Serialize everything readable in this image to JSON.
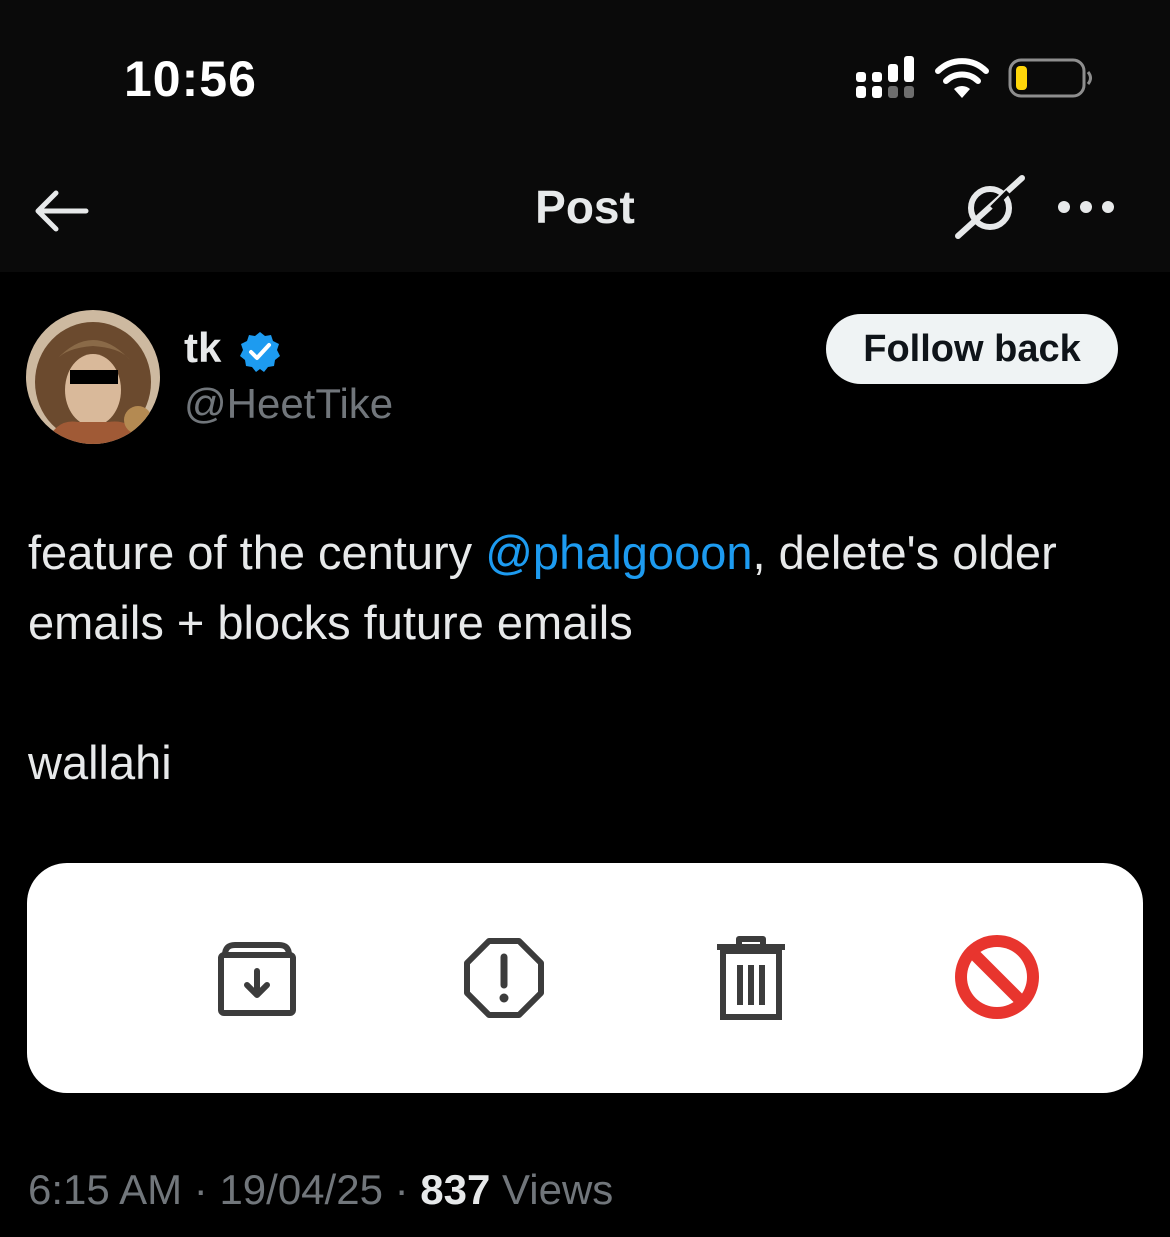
{
  "status_bar": {
    "time": "10:56",
    "icons": [
      "signal-icon",
      "wifi-icon",
      "battery-icon"
    ],
    "battery_color": "#ffd60a"
  },
  "nav": {
    "title": "Post",
    "icons": [
      "back-arrow-icon",
      "grok-icon",
      "more-options-icon"
    ]
  },
  "author": {
    "display_name": "tk",
    "handle": "@HeetTike",
    "verified": true,
    "follow_button": "Follow back"
  },
  "post": {
    "text_prefix": "feature of the century ",
    "mention": "@phalgooon",
    "text_suffix": ", delete's older emails + blocks future emails",
    "text_second": "wallahi",
    "media_icons": [
      "archive-icon",
      "report-spam-icon",
      "trash-icon",
      "block-icon"
    ]
  },
  "meta": {
    "time": "6:15 AM",
    "separator": " · ",
    "date": "19/04/25",
    "views_count": "837",
    "views_label": " Views"
  },
  "colors": {
    "background": "#000000",
    "accent": "#1d9bf0",
    "secondary_text": "#71767b",
    "primary_text": "#e7e9ea"
  }
}
